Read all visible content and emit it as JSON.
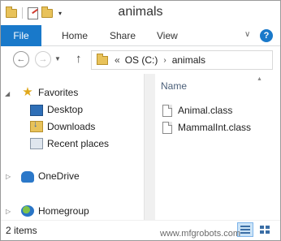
{
  "window": {
    "title": "animals"
  },
  "quick_access_toolbar": {
    "icons": [
      "folder-icon",
      "properties-icon",
      "new-folder-icon"
    ],
    "dropdown_glyph": "▾"
  },
  "ribbon": {
    "tabs": [
      {
        "label": "File",
        "active": true
      },
      {
        "label": "Home"
      },
      {
        "label": "Share"
      },
      {
        "label": "View"
      }
    ],
    "accent_color": "#1979ca",
    "help_glyph": "?"
  },
  "address": {
    "overflow_glyph": "«",
    "breadcrumb": [
      "OS (C:)",
      "animals"
    ],
    "separator_glyph": "›"
  },
  "nav_pane": {
    "favorites": {
      "label": "Favorites",
      "items": [
        {
          "label": "Desktop",
          "icon": "desktop-icon"
        },
        {
          "label": "Downloads",
          "icon": "downloads-icon"
        },
        {
          "label": "Recent places",
          "icon": "recent-places-icon"
        }
      ]
    },
    "onedrive": {
      "label": "OneDrive"
    },
    "homegroup": {
      "label": "Homegroup"
    }
  },
  "content": {
    "column_header": "Name",
    "files": [
      {
        "name": "Animal.class"
      },
      {
        "name": "MammalInt.class"
      }
    ]
  },
  "status_bar": {
    "item_count": "2 items",
    "views": [
      "details-view",
      "large-icons-view"
    ],
    "active_view": "details-view"
  },
  "watermark": {
    "text": "www.mfgrobots.com"
  }
}
